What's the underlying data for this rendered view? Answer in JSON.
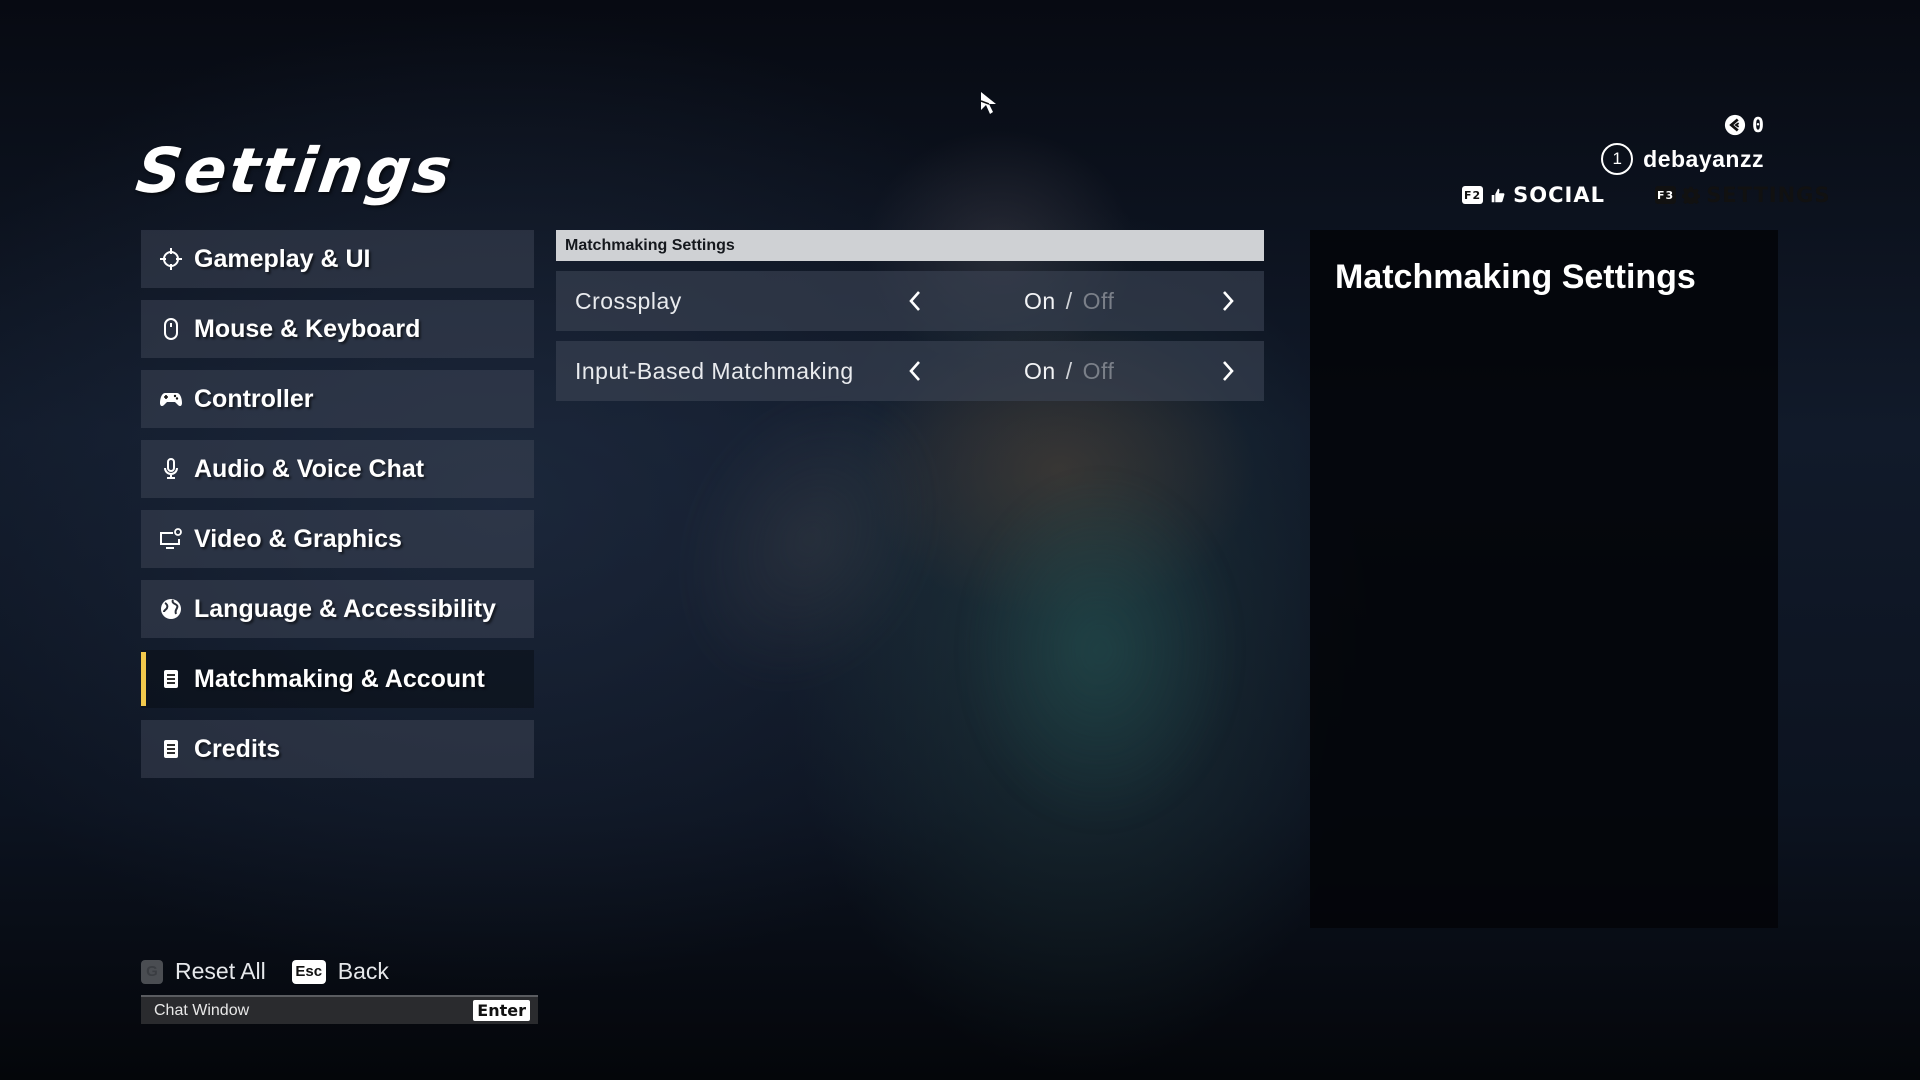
{
  "page": {
    "title": "Settings"
  },
  "topbar": {
    "currency": {
      "icon": "currency-coin-icon",
      "amount": "0"
    },
    "user": {
      "level": "1",
      "name": "debayanzz"
    },
    "tabs": [
      {
        "key": "F2",
        "icon": "social-hand-icon",
        "label": "SOCIAL",
        "active": false
      },
      {
        "key": "F3",
        "icon": "gear-icon",
        "label": "SETTINGS",
        "active": true
      }
    ]
  },
  "sidebar": {
    "items": [
      {
        "label": "Gameplay & UI",
        "icon": "crosshair-icon",
        "active": false
      },
      {
        "label": "Mouse & Keyboard",
        "icon": "mouse-icon",
        "active": false
      },
      {
        "label": "Controller",
        "icon": "gamepad-icon",
        "active": false
      },
      {
        "label": "Audio & Voice Chat",
        "icon": "microphone-icon",
        "active": false
      },
      {
        "label": "Video & Graphics",
        "icon": "monitor-gear-icon",
        "active": false
      },
      {
        "label": "Language & Accessibility",
        "icon": "globe-icon",
        "active": false
      },
      {
        "label": "Matchmaking & Account",
        "icon": "document-list-icon",
        "active": true
      },
      {
        "label": "Credits",
        "icon": "document-list-icon",
        "active": false
      }
    ],
    "accent_color": "#f2c94c"
  },
  "content": {
    "section_title": "Matchmaking Settings",
    "settings": [
      {
        "label": "Crossplay",
        "options": [
          "On",
          "Off"
        ],
        "selected": "On",
        "separator": "/"
      },
      {
        "label": "Input-Based Matchmaking",
        "options": [
          "On",
          "Off"
        ],
        "selected": "On",
        "separator": "/"
      }
    ]
  },
  "info_panel": {
    "title": "Matchmaking Settings"
  },
  "footer": {
    "reset": {
      "key": "G",
      "label": "Reset All"
    },
    "back": {
      "key": "Esc",
      "label": "Back"
    },
    "chat": {
      "label": "Chat Window",
      "key": "Enter"
    }
  }
}
